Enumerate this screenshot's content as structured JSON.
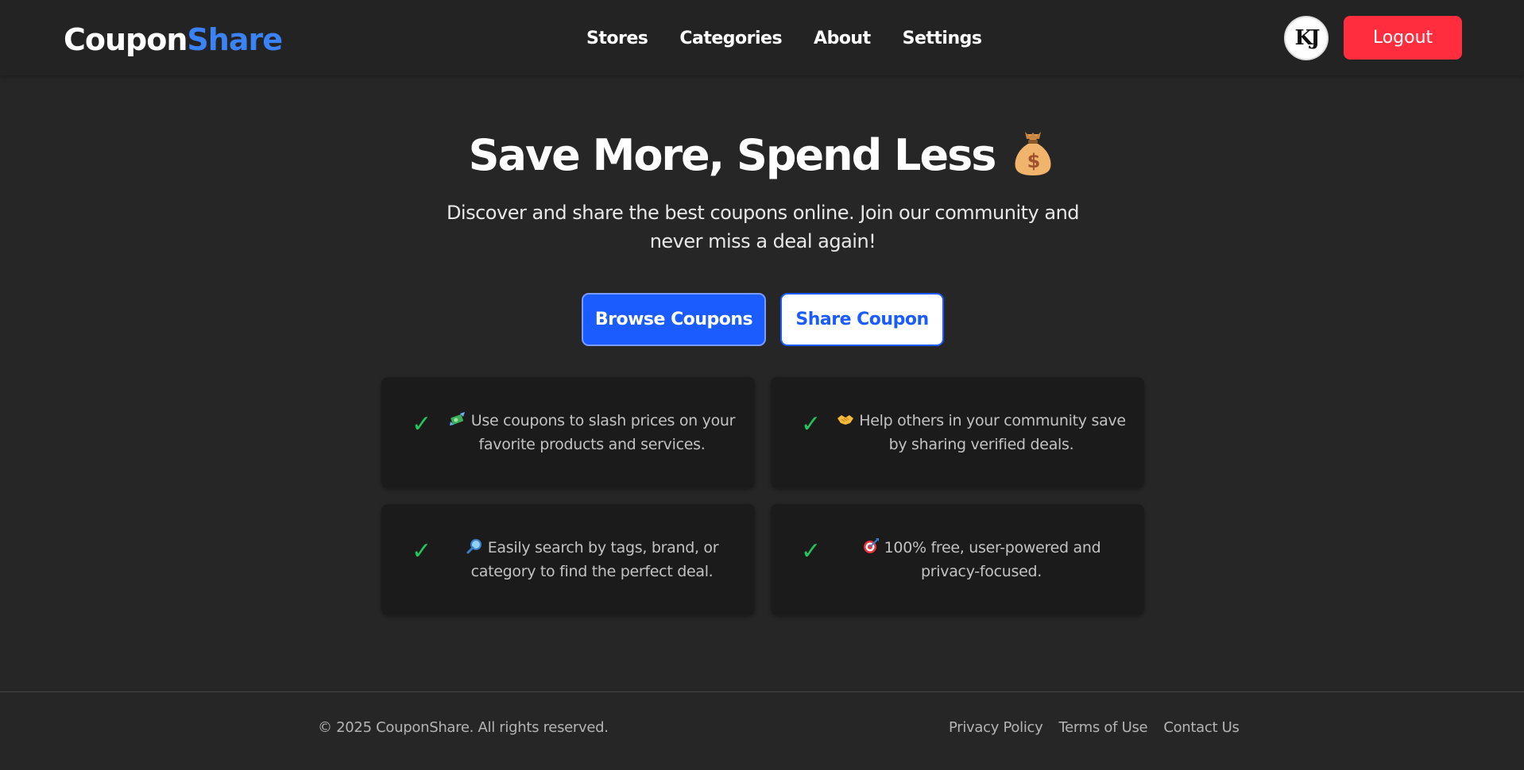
{
  "navbar": {
    "logo_part1": "Coupon",
    "logo_part2": "Share",
    "links": [
      "Stores",
      "Categories",
      "About",
      "Settings"
    ],
    "avatar_text": "KJ",
    "logout_label": "Logout"
  },
  "hero": {
    "title": "Save More, Spend Less",
    "title_icon": "money-bag-icon",
    "subtitle": "Discover and share the best coupons online. Join our community and never miss a deal again!",
    "browse_label": "Browse Coupons",
    "share_label": "Share Coupon"
  },
  "features": [
    {
      "check": "✓",
      "icon": "flying-money-icon",
      "text": "Use coupons to slash prices on your favorite products and services."
    },
    {
      "check": "✓",
      "icon": "handshake-icon",
      "text": "Help others in your community save by sharing verified deals."
    },
    {
      "check": "✓",
      "icon": "magnifying-glass-icon",
      "text": "Easily search by tags, brand, or category to find the perfect deal."
    },
    {
      "check": "✓",
      "icon": "target-icon",
      "text": "100% free, user-powered and privacy-focused."
    }
  ],
  "footer": {
    "copyright": "© 2025 CouponShare. All rights reserved.",
    "links": [
      "Privacy Policy",
      "Terms of Use",
      "Contact Us"
    ]
  },
  "colors": {
    "background": "#262626",
    "navbar": "#232323",
    "brand_blue": "#3b82f6",
    "primary_button": "#1a5cff",
    "logout_red": "#ff2d3d",
    "card_background": "#1b1b1b",
    "check_green": "#22c55e"
  }
}
